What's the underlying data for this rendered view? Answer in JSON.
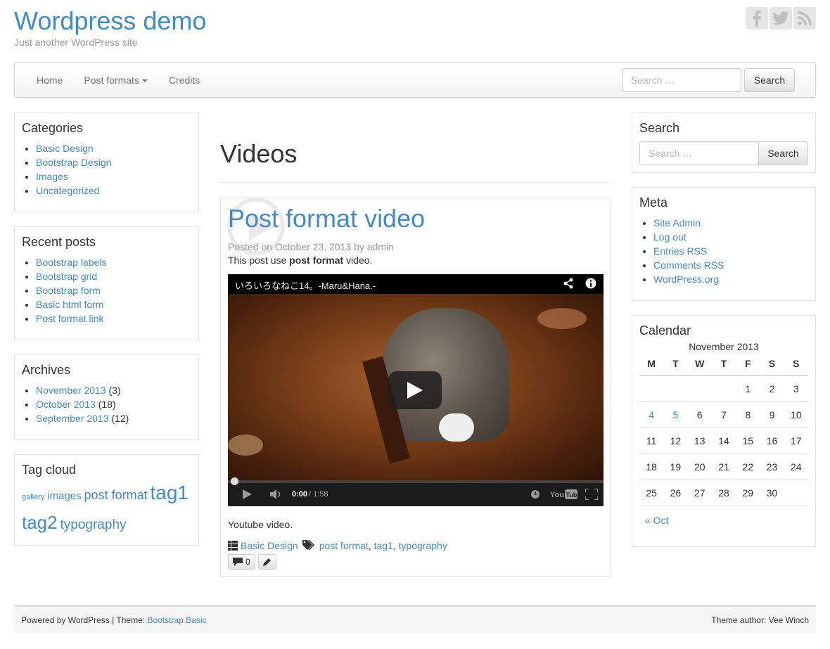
{
  "site": {
    "title": "Wordpress demo",
    "tagline": "Just another WordPress site"
  },
  "social": [
    {
      "icon": "facebook-icon",
      "glyph": "f"
    },
    {
      "icon": "twitter-icon",
      "glyph": "t"
    },
    {
      "icon": "rss-icon",
      "glyph": "rss"
    }
  ],
  "nav": {
    "home": "Home",
    "post_formats": "Post formats",
    "credits": "Credits",
    "search_placeholder": "Search …",
    "search_button": "Search"
  },
  "sidebar_left": {
    "categories": {
      "title": "Categories",
      "items": [
        "Basic Design",
        "Bootstrap Design",
        "Images",
        "Uncategorized"
      ]
    },
    "recent_posts": {
      "title": "Recent posts",
      "items": [
        "Bootstrap labels",
        "Bootstrap grid",
        "Bootstrap form",
        "Basic html form",
        "Post format link"
      ]
    },
    "archives": {
      "title": "Archives",
      "items": [
        {
          "label": "November 2013",
          "count": "(3)"
        },
        {
          "label": "October 2013",
          "count": "(18)"
        },
        {
          "label": "September 2013",
          "count": "(12)"
        }
      ]
    },
    "tag_cloud": {
      "title": "Tag cloud",
      "tags": [
        "gallery",
        "images",
        "post format",
        "tag1",
        "tag2",
        "typography"
      ]
    }
  },
  "main": {
    "page_title": "Videos",
    "post": {
      "title": "Post format video",
      "posted_on": "Posted on",
      "date": "October 23, 2013",
      "by": "by",
      "author": "admin",
      "intro_pre": "This post use",
      "intro_bold": "post format",
      "intro_post": "video.",
      "video_title": "いろいろなねこ14。-Maru&Hana.-",
      "video_time": "0:00",
      "video_duration": "/ 1:58",
      "after_text": "Youtube video.",
      "category": "Basic Design",
      "tags": [
        "post format",
        "tag1",
        "typography"
      ],
      "comments_count": "0"
    }
  },
  "sidebar_right": {
    "search": {
      "title": "Search",
      "placeholder": "Search …",
      "button": "Search"
    },
    "meta": {
      "title": "Meta",
      "items": [
        "Site Admin",
        "Log out",
        "Entries RSS",
        "Comments RSS",
        "WordPress.org"
      ]
    },
    "calendar": {
      "title": "Calendar",
      "caption": "November 2013",
      "days": [
        "M",
        "T",
        "W",
        "T",
        "F",
        "S",
        "S"
      ],
      "weeks": [
        [
          "",
          "",
          "",
          "",
          "1",
          "2",
          "3"
        ],
        [
          "4",
          "5",
          "6",
          "7",
          "8",
          "9",
          "10"
        ],
        [
          "11",
          "12",
          "13",
          "14",
          "15",
          "16",
          "17"
        ],
        [
          "18",
          "19",
          "20",
          "21",
          "22",
          "23",
          "24"
        ],
        [
          "25",
          "26",
          "27",
          "28",
          "29",
          "30",
          ""
        ]
      ],
      "linked_days": [
        "4",
        "5"
      ],
      "prev": "« Oct"
    }
  },
  "footer": {
    "powered": "Powered by WordPress | Theme:",
    "theme_link": "Bootstrap Basic",
    "author": "Theme author: Vee Winch"
  }
}
